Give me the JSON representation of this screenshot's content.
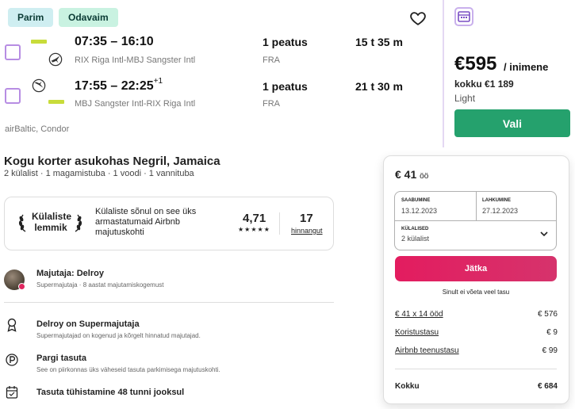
{
  "flight": {
    "tags": [
      "Parim",
      "Odavaim"
    ],
    "legs": [
      {
        "time": "07:35 – 16:10",
        "plus_days": "",
        "route": "RIX Riga Intl-MBJ Sangster Intl",
        "stops": "1 peatus",
        "stop_code": "FRA",
        "duration": "15 t 35 m"
      },
      {
        "time": "17:55 – 22:25",
        "plus_days": "+1",
        "route": "MBJ Sangster Intl-RIX Riga Intl",
        "stops": "1 peatus",
        "stop_code": "FRA",
        "duration": "21 t 30 m"
      }
    ],
    "carriers": "airBaltic, Condor",
    "price": "€595",
    "per_person": "/ inimene",
    "total": "kokku €1 189",
    "fare_class": "Light",
    "select_label": "Vali",
    "colors": {
      "select_button": "#25a16d",
      "checkbox_border": "#b78de3",
      "airline_stripe": "#c8dc3a"
    }
  },
  "listing": {
    "title": "Kogu korter asukohas Negril, Jamaica",
    "subtitle": "2 külalist · 1 magamistuba · 1 voodi · 1 vannituba",
    "guest_favorite": {
      "title": "Külaliste lemmik",
      "text": "Külaliste sõnul on see üks armastatumaid Airbnb majutuskohti",
      "rating": "4,71",
      "stars": "★★★★★",
      "reviews_count": "17",
      "reviews_label": "hinnangut"
    },
    "host": {
      "title": "Majutaja: Delroy",
      "subtitle": "Supermajutaja · 8 aastat majutamiskogemust"
    },
    "features": [
      {
        "icon": "medal-icon",
        "title": "Delroy on Supermajutaja",
        "subtitle": "Supermajutajad on kogenud ja kõrgelt hinnatud majutajad."
      },
      {
        "icon": "parking-icon",
        "title": "Pargi tasuta",
        "subtitle": "See on piirkonnas üks väheseid tasuta parkimisega majutuskohti."
      },
      {
        "icon": "calendar-icon",
        "title": "Tasuta tühistamine 48 tunni jooksul",
        "subtitle": ""
      }
    ]
  },
  "booking": {
    "price": "€ 41",
    "per_night": "öö",
    "checkin_label": "SAABUMINE",
    "checkin_value": "13.12.2023",
    "checkout_label": "LAHKUMINE",
    "checkout_value": "27.12.2023",
    "guests_label": "KÜLALISED",
    "guests_value": "2 külalist",
    "continue_label": "Jätka",
    "no_charge": "Sinult ei võeta veel tasu",
    "lines": [
      {
        "label": "€ 41 x 14 ööd",
        "value": "€ 576"
      },
      {
        "label": "Koristustasu",
        "value": "€ 9"
      },
      {
        "label": "Airbnb teenustasu",
        "value": "€ 99"
      }
    ],
    "total_label": "Kokku",
    "total_value": "€ 684",
    "colors": {
      "continue_button": "#e31c5f"
    }
  }
}
